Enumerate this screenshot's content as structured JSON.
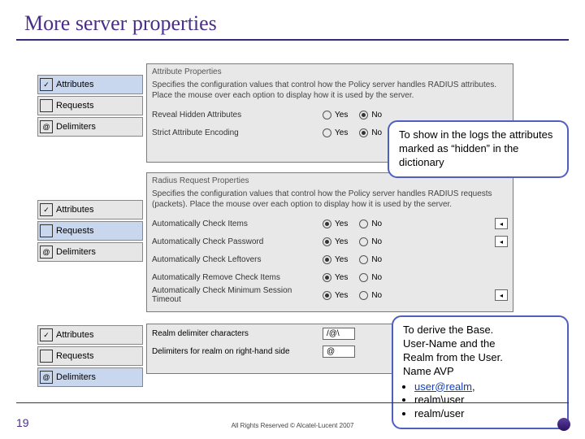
{
  "title": "More server properties",
  "page_number": "19",
  "copyright": "All Rights Reserved © Alcatel-Lucent 2007",
  "nav_labels": {
    "attributes": "Attributes",
    "requests": "Requests",
    "delimiters": "Delimiters"
  },
  "nav_icons": {
    "attributes_alt": "checkbox-icon",
    "requests_alt": "card-icon",
    "delimiters_alt": "at-icon",
    "at_glyph": "@",
    "check_glyph": "✓"
  },
  "radio": {
    "yes": "Yes",
    "no": "No"
  },
  "panel1": {
    "header": "Attribute Properties",
    "desc": "Specifies the configuration values that control how the Policy server handles RADIUS attributes. Place the mouse over each option to display how it is used by the server.",
    "rows": [
      {
        "label": "Reveal Hidden Attributes",
        "yes": false,
        "no": true
      },
      {
        "label": "Strict Attribute Encoding",
        "yes": false,
        "no": true
      }
    ]
  },
  "panel2": {
    "header": "Radius Request Properties",
    "desc": "Specifies the configuration values that control how the Policy server handles RADIUS requests (packets). Place the mouse over each option to display how it is used by the server.",
    "rows": [
      {
        "label": "Automatically Check Items",
        "yes": true,
        "no": false,
        "help": true
      },
      {
        "label": "Automatically Check Password",
        "yes": true,
        "no": false,
        "help": true
      },
      {
        "label": "Automatically Check Leftovers",
        "yes": true,
        "no": false
      },
      {
        "label": "Automatically Remove Check Items",
        "yes": true,
        "no": false
      },
      {
        "label": "Automatically Check Minimum Session Timeout",
        "yes": true,
        "no": false,
        "help": true
      }
    ]
  },
  "panel3": {
    "rows": [
      {
        "label": "Realm delimiter characters",
        "value": "/@\\"
      },
      {
        "label": "Delimiters for realm on right-hand side",
        "value": "@"
      }
    ]
  },
  "callout1": "To show in the logs the attributes marked as “hidden” in the dictionary",
  "callout2": {
    "line1": "To derive the Base.",
    "line2": "User-Name and the",
    "line3": "Realm from the User.",
    "line4": "Name AVP",
    "bullets": [
      "user@realm,",
      "realm\\user",
      "realm/user"
    ],
    "link_text": "user@realm"
  }
}
